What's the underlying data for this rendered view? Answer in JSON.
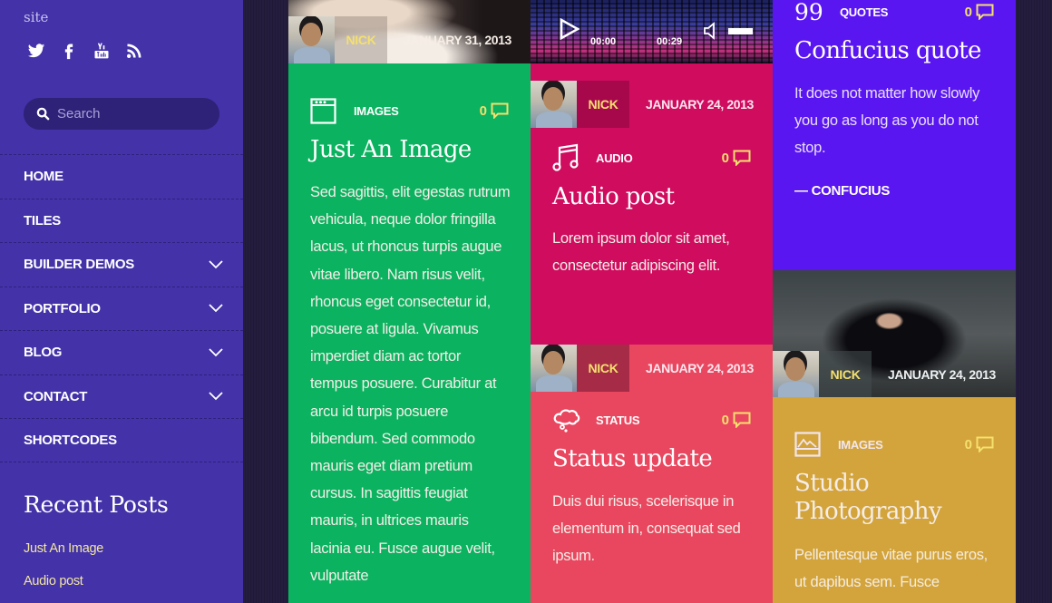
{
  "sidebar": {
    "site_text": "site",
    "social": [
      "twitter-icon",
      "facebook-icon",
      "youtube-icon",
      "rss-icon"
    ],
    "search": {
      "placeholder": "Search",
      "value": ""
    },
    "nav": [
      {
        "label": "HOME",
        "has_submenu": false
      },
      {
        "label": "TILES",
        "has_submenu": false
      },
      {
        "label": "BUILDER DEMOS",
        "has_submenu": true
      },
      {
        "label": "PORTFOLIO",
        "has_submenu": true
      },
      {
        "label": "BLOG",
        "has_submenu": true
      },
      {
        "label": "CONTACT",
        "has_submenu": true
      },
      {
        "label": "SHORTCODES",
        "has_submenu": false
      }
    ],
    "recent_posts_title": "Recent Posts",
    "recent_posts": [
      "Just An Image",
      "Audio post"
    ]
  },
  "colors": {
    "sidebar": "#4332a8",
    "green": "#0bb25f",
    "magenta": "#cf0c5e",
    "coral": "#e9475f",
    "violet": "#5a16f0",
    "mustard": "#d3a43b",
    "accent_yellow": "#f4e06e"
  },
  "posts": [
    {
      "author": "NICK",
      "date": "JANUARY 31, 2013",
      "type": "IMAGES",
      "type_icon": "gallery-icon",
      "comments": "0",
      "title": "Just An Image",
      "body": "Sed sagittis, elit egestas rutrum vehicula, neque dolor fringilla lacus, ut rhoncus turpis augue vitae libero. Nam risus velit, rhoncus eget consectetur id, posuere at ligula. Vivamus imperdiet diam ac tortor tempus posuere. Curabitur at arcu id turpis posuere bibendum. Sed commodo mauris eget diam pretium cursus. In sagittis feugiat mauris, in ultrices mauris lacinia eu. Fusce augue velit, vulputate"
    },
    {
      "author": "NICK",
      "date": "JANUARY 24, 2013",
      "type": "AUDIO",
      "type_icon": "music-note-icon",
      "comments": "0",
      "title": "Audio post",
      "body": "Lorem ipsum dolor sit amet, consectetur adipiscing elit.",
      "player": {
        "current_time": "00:00",
        "duration": "00:29"
      }
    },
    {
      "author": "NICK",
      "date": "JANUARY 24, 2013",
      "type": "STATUS",
      "type_icon": "thought-bubble-icon",
      "comments": "0",
      "title": "Status update",
      "body": "Duis dui risus, scelerisque in elementum in, consequat sed ipsum."
    },
    {
      "type": "QUOTES",
      "type_icon": "quote-icon",
      "type_glyph": "99",
      "comments": "0",
      "title": "Confucius quote",
      "body": "It does not matter how slowly you go as long as you do not stop.",
      "attribution": "— CONFUCIUS"
    },
    {
      "author": "NICK",
      "date": "JANUARY 24, 2013",
      "type": "IMAGES",
      "type_icon": "picture-icon",
      "comments": "0",
      "title": "Studio Photography",
      "body": "Pellentesque vitae purus eros, ut dapibus sem. Fusce"
    }
  ]
}
